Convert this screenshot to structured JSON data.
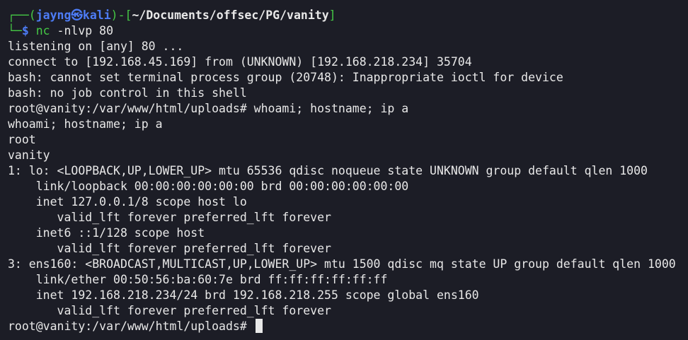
{
  "prompt": {
    "corner_top": "┌──(",
    "user": "jayng",
    "at_symbol": "㉿",
    "host": "kali",
    "bracket_mid": ")-[",
    "path": "~/Documents/offsec/PG/vanity",
    "bracket_end": "]",
    "corner_bottom": "└─",
    "dollar": "$",
    "cmd_name": "nc",
    "cmd_args": " -nlvp 80"
  },
  "output": [
    "listening on [any] 80 ...",
    "connect to [192.168.45.169] from (UNKNOWN) [192.168.218.234] 35704",
    "bash: cannot set terminal process group (20748): Inappropriate ioctl for device",
    "bash: no job control in this shell",
    "root@vanity:/var/www/html/uploads# whoami; hostname; ip a",
    "whoami; hostname; ip a",
    "root",
    "vanity",
    "1: lo: <LOOPBACK,UP,LOWER_UP> mtu 65536 qdisc noqueue state UNKNOWN group default qlen 1000",
    "    link/loopback 00:00:00:00:00:00 brd 00:00:00:00:00:00",
    "    inet 127.0.0.1/8 scope host lo",
    "       valid_lft forever preferred_lft forever",
    "    inet6 ::1/128 scope host",
    "       valid_lft forever preferred_lft forever",
    "3: ens160: <BROADCAST,MULTICAST,UP,LOWER_UP> mtu 1500 qdisc mq state UP group default qlen 1000",
    "    link/ether 00:50:56:ba:60:7e brd ff:ff:ff:ff:ff:ff",
    "    inet 192.168.218.234/24 brd 192.168.218.255 scope global ens160",
    "       valid_lft forever preferred_lft forever"
  ],
  "final_prompt": "root@vanity:/var/www/html/uploads# ",
  "colors": {
    "background": "#1c1d26",
    "prompt_green": "#45c845",
    "prompt_blue": "#4d7cf5",
    "text": "#e8e8e8"
  }
}
